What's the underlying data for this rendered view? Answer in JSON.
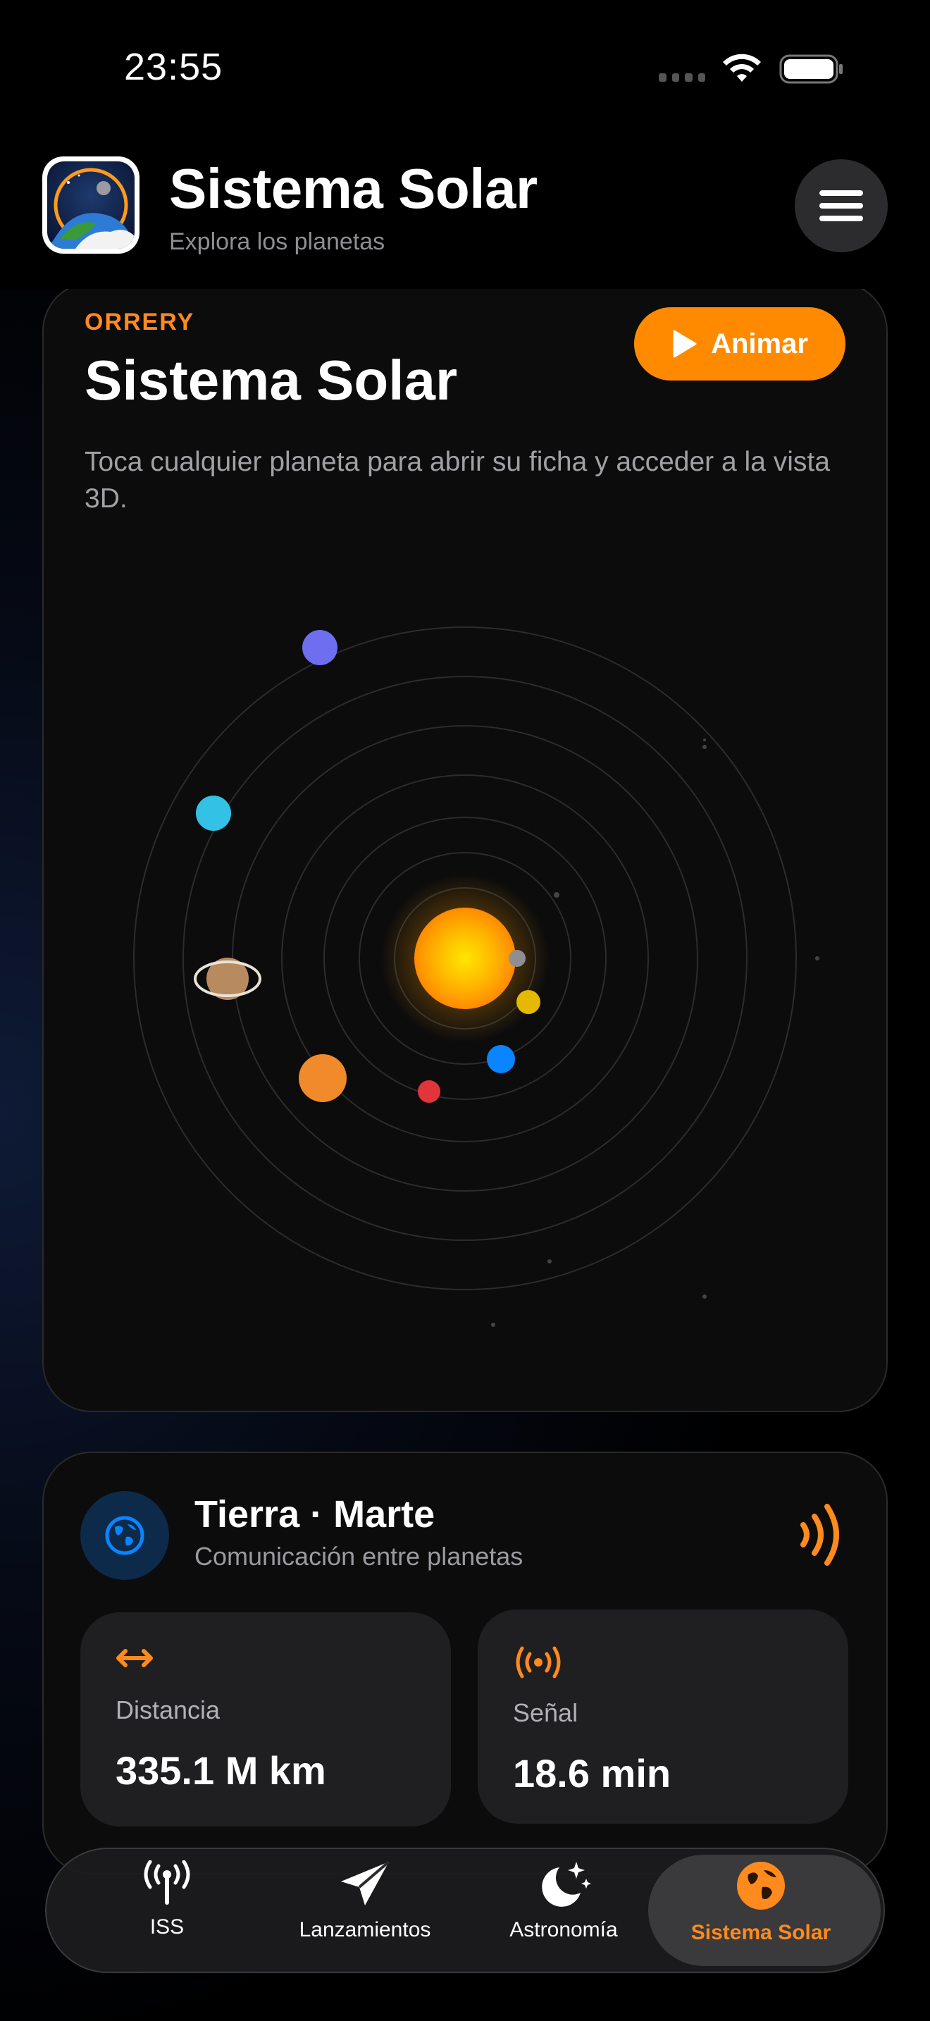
{
  "status_bar": {
    "time": "23:55"
  },
  "header": {
    "title": "Sistema Solar",
    "subtitle": "Explora los planetas",
    "menu_icon": "hamburger-icon"
  },
  "orrery": {
    "eyebrow": "ORRERY",
    "title": "Sistema Solar",
    "description": "Toca cualquier planeta para abrir su ficha y acceder a la vista 3D.",
    "animate_label": "Animar",
    "planets": [
      {
        "name": "mercury",
        "color": "#8e8e93"
      },
      {
        "name": "venus",
        "color": "#e6b800"
      },
      {
        "name": "earth",
        "color": "#0a84ff"
      },
      {
        "name": "mars",
        "color": "#e0353b"
      },
      {
        "name": "jupiter",
        "color": "#f08a2a"
      },
      {
        "name": "saturn",
        "color": "#b78a60"
      },
      {
        "name": "uranus",
        "color": "#34c1e6"
      },
      {
        "name": "neptune",
        "color": "#6e6ef0"
      }
    ],
    "sun_color": "#ffb000"
  },
  "comms": {
    "title": "Tierra · Marte",
    "subtitle": "Comunicación entre planetas",
    "distance_label": "Distancia",
    "distance_value": "335.1 M km",
    "signal_label": "Señal",
    "signal_value": "18.6 min",
    "accent": "#ff8a1e"
  },
  "tabs": [
    {
      "label": "ISS",
      "icon": "antenna-icon"
    },
    {
      "label": "Lanzamientos",
      "icon": "paperplane-icon"
    },
    {
      "label": "Astronomía",
      "icon": "moon-stars-icon"
    },
    {
      "label": "Sistema Solar",
      "icon": "globe-icon",
      "active": true
    }
  ]
}
